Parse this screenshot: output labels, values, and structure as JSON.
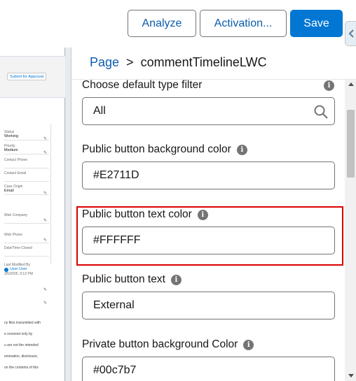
{
  "toolbar": {
    "analyze_label": "Analyze",
    "activation_label": "Activation...",
    "save_label": "Save"
  },
  "canvas": {
    "header_button": "Submit for Approval",
    "fields": [
      {
        "label": "Status",
        "value": "Working"
      },
      {
        "label": "Priority",
        "value": "Medium"
      },
      {
        "label": "Contact Phone",
        "value": ""
      },
      {
        "label": "Contact Email",
        "value": ""
      },
      {
        "label": "Case Origin",
        "value": "Email"
      },
      {
        "label": "Web Company",
        "value": ""
      },
      {
        "label": "Web Phone",
        "value": ""
      },
      {
        "label": "Date/Time Closed",
        "value": ""
      }
    ],
    "last_modified_label": "Last Modified By",
    "last_modified_user": "User User",
    "last_modified_time": "3/5/2025, 9:12 PM",
    "body_lines": [
      "ny files transmitted with",
      "e received only by",
      "u are not the intended",
      "emination, disclosure,",
      "on the contents of this"
    ]
  },
  "panel": {
    "breadcrumb_root": "Page",
    "breadcrumb_separator": ">",
    "breadcrumb_current": "commentTimelineLWC",
    "fields": [
      {
        "label": "Choose default type filter",
        "value": "All"
      },
      {
        "label": "Public button background color",
        "value": "#E2711D"
      },
      {
        "label": "Public button text color",
        "value": "#FFFFFF"
      },
      {
        "label": "Public button text",
        "value": "External"
      },
      {
        "label": "Private button background Color",
        "value": "#00c7b7"
      }
    ]
  },
  "colors": {
    "brand": "#0176d3",
    "highlight": "#dc0000"
  }
}
